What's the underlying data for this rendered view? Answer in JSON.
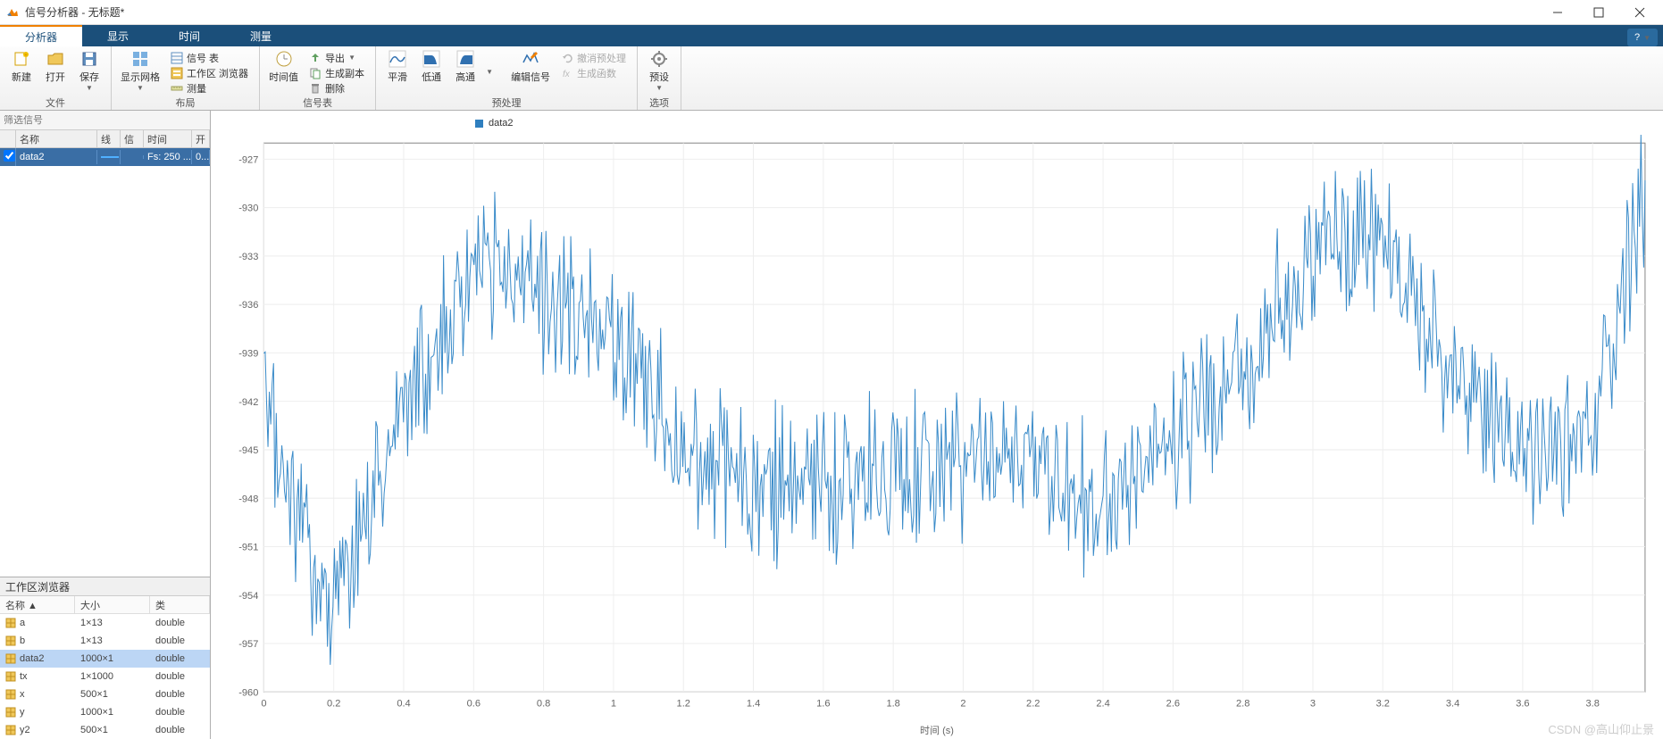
{
  "titlebar": {
    "title": "信号分析器 - 无标题*"
  },
  "tabs": {
    "items": [
      "分析器",
      "显示",
      "时间",
      "测量"
    ],
    "active": 0,
    "help_tip": "?"
  },
  "toolstrip": {
    "file": {
      "new": "新建",
      "open": "打开",
      "save": "保存",
      "group": "文件"
    },
    "layout": {
      "grid": "显示网格",
      "sigtable": "信号 表",
      "wsbrowser": "工作区 浏览器",
      "measure": "测量",
      "group": "布局"
    },
    "sigtable": {
      "timevals": "时间值",
      "export": "导出",
      "gencopy": "生成副本",
      "delete": "删除",
      "group": "信号表"
    },
    "preproc": {
      "smooth": "平滑",
      "lowpass": "低通",
      "highpass": "高通",
      "editsig": "编辑信号",
      "undo": "撤消预处理",
      "genfunc": "生成函数",
      "group": "预处理"
    },
    "options": {
      "presets": "预设",
      "group": "选项"
    }
  },
  "filter": {
    "placeholder": "筛选信号"
  },
  "sig_table": {
    "headers": {
      "name": "名称",
      "line": "线条",
      "info": "信息",
      "time": "时间",
      "open": "开"
    },
    "row": {
      "name": "data2",
      "time": "Fs: 250 ...",
      "open": "0..."
    }
  },
  "workspace": {
    "title": "工作区浏览器",
    "headers": {
      "name": "名称 ▲",
      "size": "大小",
      "class": "类"
    },
    "rows": [
      {
        "name": "a",
        "size": "1×13",
        "class": "double",
        "sel": false
      },
      {
        "name": "b",
        "size": "1×13",
        "class": "double",
        "sel": false
      },
      {
        "name": "data2",
        "size": "1000×1",
        "class": "double",
        "sel": true
      },
      {
        "name": "tx",
        "size": "1×1000",
        "class": "double",
        "sel": false
      },
      {
        "name": "x",
        "size": "500×1",
        "class": "double",
        "sel": false
      },
      {
        "name": "y",
        "size": "1000×1",
        "class": "double",
        "sel": false
      },
      {
        "name": "y2",
        "size": "500×1",
        "class": "double",
        "sel": false
      }
    ]
  },
  "chart": {
    "legend": "data2",
    "xlabel": "时间 (s)"
  },
  "watermark": "CSDN @高山仰止景",
  "chart_data": {
    "type": "line",
    "title": "",
    "xlabel": "时间 (s)",
    "ylabel": "",
    "xlim": [
      0,
      3.95
    ],
    "ylim": [
      -960,
      -926
    ],
    "xticks": [
      0,
      0.2,
      0.4,
      0.6,
      0.8,
      1.0,
      1.2,
      1.4,
      1.6,
      1.8,
      2.0,
      2.2,
      2.4,
      2.6,
      2.8,
      3.0,
      3.2,
      3.4,
      3.6,
      3.8
    ],
    "yticks": [
      -960,
      -957,
      -954,
      -951,
      -948,
      -945,
      -942,
      -939,
      -936,
      -933,
      -930,
      -927
    ],
    "series": [
      {
        "name": "data2"
      }
    ],
    "note": "1000-point noisy waveform centered roughly around -945, drifting up near x~0.5 and x~3.1, dipping near x~0.2 and x~1.3; representative values sampled at xticks",
    "x_sample": [
      0,
      0.2,
      0.4,
      0.6,
      0.8,
      1.0,
      1.2,
      1.4,
      1.6,
      1.8,
      2.0,
      2.2,
      2.4,
      2.6,
      2.8,
      3.0,
      3.2,
      3.4,
      3.6,
      3.8,
      3.95
    ],
    "y_sample": [
      -943,
      -955,
      -942,
      -934,
      -935,
      -938,
      -945,
      -947,
      -948,
      -946,
      -946,
      -946,
      -949,
      -944,
      -940,
      -933,
      -932,
      -941,
      -945,
      -944,
      -929
    ]
  }
}
